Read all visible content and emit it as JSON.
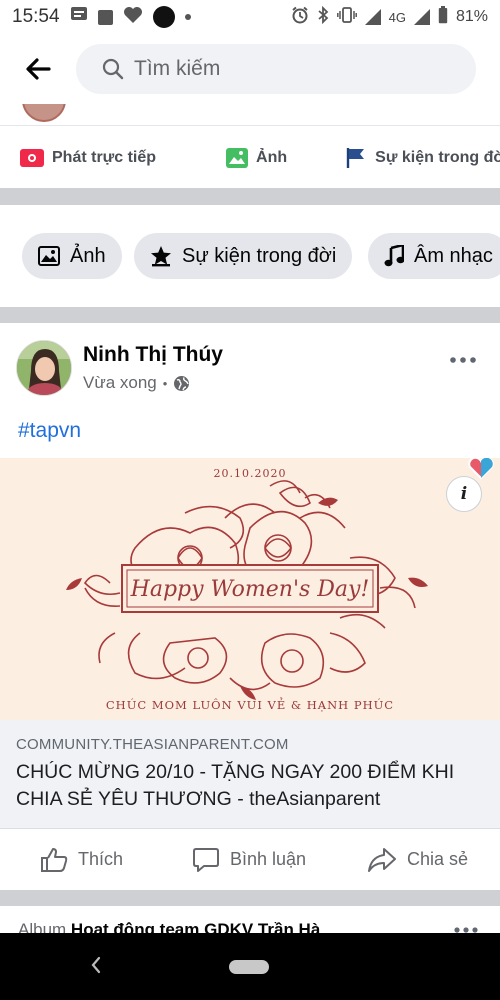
{
  "status_bar": {
    "time": "15:54",
    "network": "4G",
    "battery": "81%"
  },
  "search": {
    "placeholder": "Tìm kiếm"
  },
  "composer": {
    "items": [
      {
        "label": "Phát trực tiếp",
        "icon": "live-video-icon",
        "color": "#f02849"
      },
      {
        "label": "Ảnh",
        "icon": "photo-icon",
        "color": "#45bd62"
      },
      {
        "label": "Sự kiện trong đời",
        "icon": "flag-icon",
        "color": "#1877f2"
      }
    ]
  },
  "chips": [
    {
      "label": "Ảnh",
      "icon": "photo-icon"
    },
    {
      "label": "Sự kiện trong đời",
      "icon": "star-icon"
    },
    {
      "label": "Âm nhạc",
      "icon": "music-note-icon"
    }
  ],
  "post": {
    "author": "Ninh Thị Thúy",
    "time": "Vừa xong",
    "separator": "•",
    "hashtag": "#tapvn",
    "image": {
      "date": "20.10.2020",
      "banner": "Happy Women's Day!",
      "caption": "CHÚC MOM LUÔN VUI VẺ & HẠNH PHÚC"
    },
    "link": {
      "domain": "COMMUNITY.THEASIANPARENT.COM",
      "title": "CHÚC MỪNG 20/10 - TẶNG NGAY 200 ĐIỂM KHI CHIA SẺ YÊU THƯƠNG - theAsianparent"
    },
    "actions": {
      "like": "Thích",
      "comment": "Bình luận",
      "share": "Chia sẻ"
    }
  },
  "next_post": {
    "prefix": "Album",
    "title": "Hoạt động team GDKV Trần Hà"
  },
  "colors": {
    "link_blue": "#216fdb",
    "flower_red": "#a83a3a",
    "image_bg": "#fcefe2"
  }
}
